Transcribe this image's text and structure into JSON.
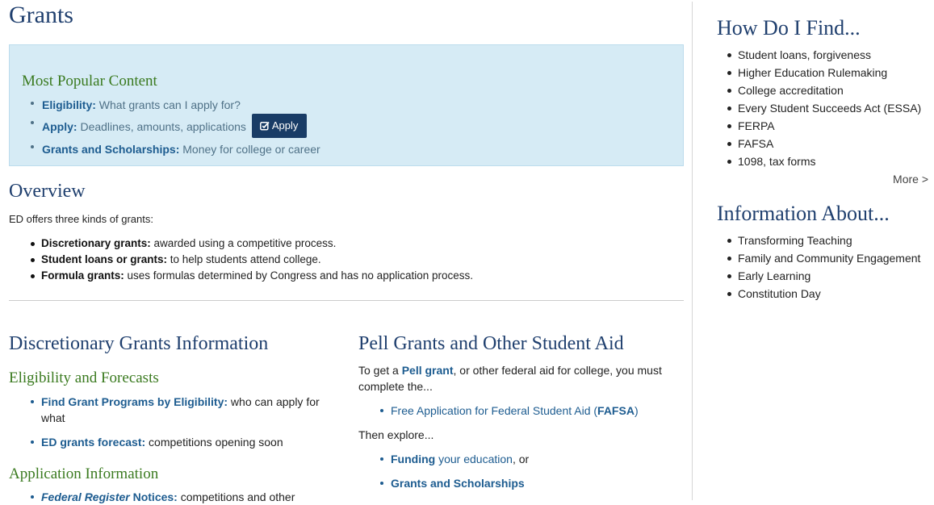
{
  "page_title": "Grants",
  "popular": {
    "heading": "Most Popular Content",
    "items": [
      {
        "label": "Eligibility:",
        "text": "What grants can I apply for?"
      },
      {
        "label": "Apply:",
        "text": "Deadlines, amounts, applications"
      },
      {
        "label": "Grants and Scholarships:",
        "text": "Money for college or career"
      }
    ],
    "apply_button": "Apply",
    "apply_icon": "edit-check-icon"
  },
  "overview": {
    "title": "Overview",
    "intro": "ED offers three kinds of grants:",
    "items": [
      {
        "label": "Discretionary grants:",
        "text": " awarded using a competitive process."
      },
      {
        "label": "Student loans or grants:",
        "text": " to help students attend college."
      },
      {
        "label": "Formula grants:",
        "text": " uses formulas determined by Congress and has no application process."
      }
    ]
  },
  "discretionary": {
    "title": "Discretionary Grants Information",
    "eligibility_heading": "Eligibility and Forecasts",
    "eligibility_items": [
      {
        "label": "Find Grant Programs by Eligibility:",
        "text": " who can apply for what"
      },
      {
        "label": "ED grants forecast:",
        "text": " competitions opening soon"
      }
    ],
    "application_heading": "Application Information",
    "application_items": [
      {
        "label_italic": "Federal Register",
        "label": " Notices:",
        "text": " competitions and other"
      }
    ]
  },
  "pell": {
    "title": "Pell Grants and Other Student Aid",
    "intro_before": "To get a ",
    "intro_link": "Pell grant",
    "intro_after": ", or other federal aid for college, you must complete the...",
    "fafsa_before": "Free Application for Federal Student Aid (",
    "fafsa_link": "FAFSA",
    "fafsa_after": ")",
    "then_explore": "Then explore...",
    "funding_bold": "Funding",
    "funding_link": " your education",
    "funding_after": ", or",
    "grants_scholarships": "Grants and Scholarships"
  },
  "sidebar": {
    "find_heading": "How Do I Find...",
    "find_items": [
      "Student loans, forgiveness",
      "Higher Education Rulemaking",
      "College accreditation",
      "Every Student Succeeds Act (ESSA)",
      "FERPA",
      "FAFSA",
      "1098, tax forms"
    ],
    "more_label": "More >",
    "about_heading": "Information About...",
    "about_items": [
      "Transforming Teaching",
      "Family and Community Engagement",
      "Early Learning",
      "Constitution Day"
    ]
  },
  "colors": {
    "heading_blue": "#1f3f6e",
    "subheading_green": "#3a7a1f",
    "link_blue": "#1d5c90",
    "popular_box_bg": "#d6ebf5",
    "apply_button_bg": "#193c66"
  }
}
